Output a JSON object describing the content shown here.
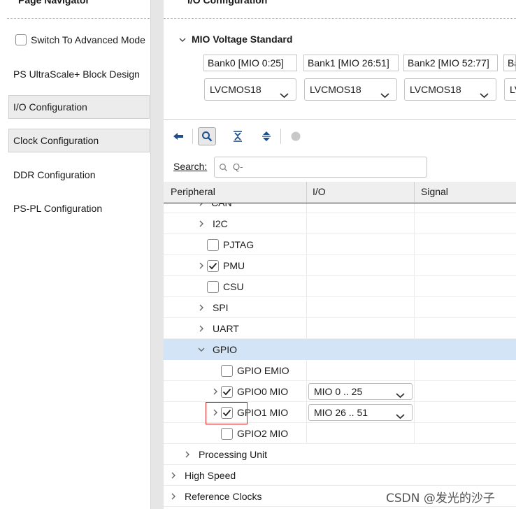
{
  "navigator": {
    "title": "Page Navigator",
    "advanced_mode_label": "Switch To Advanced Mode",
    "items": [
      {
        "label": "PS UltraScale+ Block Design",
        "selected": false
      },
      {
        "label": "I/O Configuration",
        "selected": true
      },
      {
        "label": "Clock Configuration",
        "selected": true
      },
      {
        "label": "DDR Configuration",
        "selected": false
      },
      {
        "label": "PS-PL Configuration",
        "selected": false
      }
    ]
  },
  "io_config": {
    "title": "I/O Configuration",
    "mio_voltage": {
      "section_label": "MIO Voltage Standard",
      "banks": [
        {
          "label": "Bank0 [MIO 0:25]",
          "value": "LVCMOS18"
        },
        {
          "label": "Bank1 [MIO 26:51]",
          "value": "LVCMOS18"
        },
        {
          "label": "Bank2 [MIO 52:77]",
          "value": "LVCMOS18"
        },
        {
          "label": "Ba",
          "value": "LV"
        }
      ]
    },
    "search": {
      "label": "Search:",
      "placeholder": "Q-"
    },
    "columns": {
      "peripheral": "Peripheral",
      "io": "I/O",
      "signal": "Signal"
    },
    "rows": [
      {
        "label": "CAN"
      },
      {
        "label": "I2C"
      },
      {
        "label": "PJTAG"
      },
      {
        "label": "PMU"
      },
      {
        "label": "CSU"
      },
      {
        "label": "SPI"
      },
      {
        "label": "UART"
      },
      {
        "label": "GPIO"
      },
      {
        "label": "GPIO EMIO"
      },
      {
        "label": "GPIO0 MIO",
        "io": "MIO 0 .. 25"
      },
      {
        "label": "GPIO1 MIO",
        "io": "MIO 26 .. 51"
      },
      {
        "label": "GPIO2 MIO"
      },
      {
        "label": "Processing Unit"
      },
      {
        "label": "High Speed"
      },
      {
        "label": "Reference Clocks"
      }
    ]
  },
  "watermark": "CSDN @发光的沙子",
  "colors": {
    "selection": "#d4e4f7",
    "accent": "#1f4e8c",
    "highlight_box": "#e0201e"
  }
}
